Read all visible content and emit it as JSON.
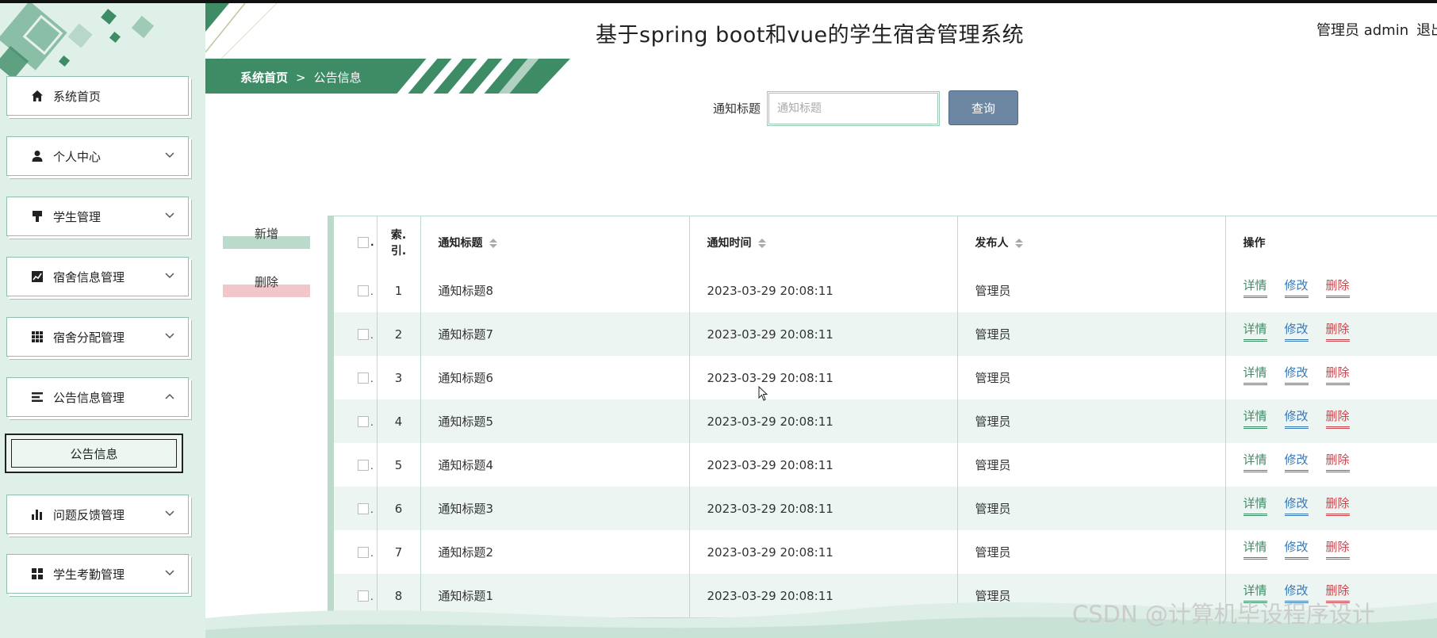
{
  "app": {
    "title": "基于spring boot和vue的学生宿舍管理系统",
    "user_label": "管理员 admin",
    "logout_label": "退出"
  },
  "breadcrumb": {
    "home": "系统首页",
    "separator": ">",
    "current": "公告信息"
  },
  "sidebar": {
    "items": [
      {
        "label": "系统首页",
        "icon": "home-icon",
        "has_submenu": false
      },
      {
        "label": "个人中心",
        "icon": "user-icon",
        "has_submenu": true
      },
      {
        "label": "学生管理",
        "icon": "brush-icon",
        "has_submenu": true
      },
      {
        "label": "宿舍信息管理",
        "icon": "line-chart-icon",
        "has_submenu": true
      },
      {
        "label": "宿舍分配管理",
        "icon": "grid-icon",
        "has_submenu": true
      },
      {
        "label": "公告信息管理",
        "icon": "list-icon",
        "has_submenu": true,
        "expanded": true
      },
      {
        "label": "问题反馈管理",
        "icon": "bar-chart-icon",
        "has_submenu": true
      },
      {
        "label": "学生考勤管理",
        "icon": "apps-icon",
        "has_submenu": true
      }
    ],
    "active_sub_item": "公告信息"
  },
  "search": {
    "label": "通知标题",
    "placeholder": "通知标题",
    "value": "",
    "button": "查询"
  },
  "actions": {
    "add": "新增",
    "delete": "删除"
  },
  "table": {
    "headers": {
      "index": "索引",
      "title": "通知标题",
      "time": "通知时间",
      "publisher": "发布人",
      "ops": "操作"
    },
    "rows": [
      {
        "index": "1",
        "title": "通知标题8",
        "time": "2023-03-29 20:08:11",
        "publisher": "管理员"
      },
      {
        "index": "2",
        "title": "通知标题7",
        "time": "2023-03-29 20:08:11",
        "publisher": "管理员"
      },
      {
        "index": "3",
        "title": "通知标题6",
        "time": "2023-03-29 20:08:11",
        "publisher": "管理员"
      },
      {
        "index": "4",
        "title": "通知标题5",
        "time": "2023-03-29 20:08:11",
        "publisher": "管理员"
      },
      {
        "index": "5",
        "title": "通知标题4",
        "time": "2023-03-29 20:08:11",
        "publisher": "管理员"
      },
      {
        "index": "6",
        "title": "通知标题3",
        "time": "2023-03-29 20:08:11",
        "publisher": "管理员"
      },
      {
        "index": "7",
        "title": "通知标题2",
        "time": "2023-03-29 20:08:11",
        "publisher": "管理员"
      },
      {
        "index": "8",
        "title": "通知标题1",
        "time": "2023-03-29 20:08:11",
        "publisher": "管理员"
      }
    ],
    "row_ops": {
      "detail": "详情",
      "edit": "修改",
      "delete": "删除"
    }
  },
  "watermark": "CSDN @计算机毕设程序设计",
  "colors": {
    "primary": "#3d8c66",
    "sidebar_bg": "#dff0e9",
    "search_button": "#6d87a3",
    "danger": "#c8464e",
    "link": "#3a78b5"
  }
}
